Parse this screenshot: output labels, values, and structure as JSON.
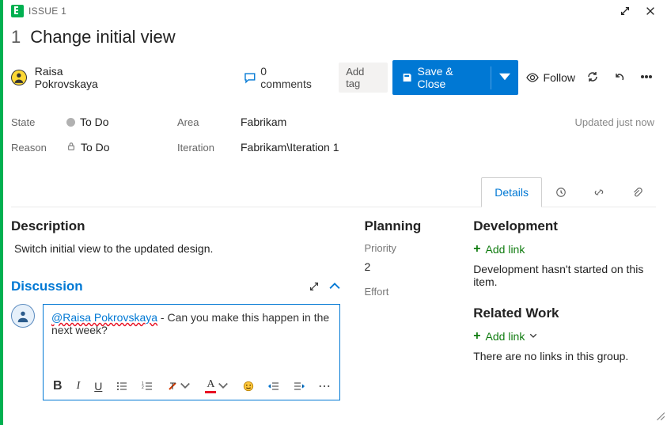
{
  "header": {
    "type_label": "ISSUE 1",
    "id": "1",
    "title": "Change initial view"
  },
  "assignee": {
    "name": "Raisa Pokrovskaya"
  },
  "comments": {
    "label": "0 comments"
  },
  "buttons": {
    "add_tag": "Add tag",
    "save": "Save & Close",
    "follow": "Follow"
  },
  "fields": {
    "state_label": "State",
    "state_value": "To Do",
    "reason_label": "Reason",
    "reason_value": "To Do",
    "area_label": "Area",
    "area_value": "Fabrikam",
    "iter_label": "Iteration",
    "iter_value": "Fabrikam\\Iteration 1",
    "updated": "Updated just now"
  },
  "tabs": {
    "details": "Details"
  },
  "description": {
    "heading": "Description",
    "text": "Switch initial view to the updated design."
  },
  "discussion": {
    "heading": "Discussion",
    "mention": "@Raisa Pokrovskaya",
    "body_rest": " - Can you make this happen in the next week?"
  },
  "planning": {
    "heading": "Planning",
    "priority_label": "Priority",
    "priority_value": "2",
    "effort_label": "Effort"
  },
  "development": {
    "heading": "Development",
    "add_link": "Add link",
    "hint": "Development hasn't started on this item."
  },
  "related": {
    "heading": "Related Work",
    "add_link": "Add link",
    "hint": "There are no links in this group."
  }
}
